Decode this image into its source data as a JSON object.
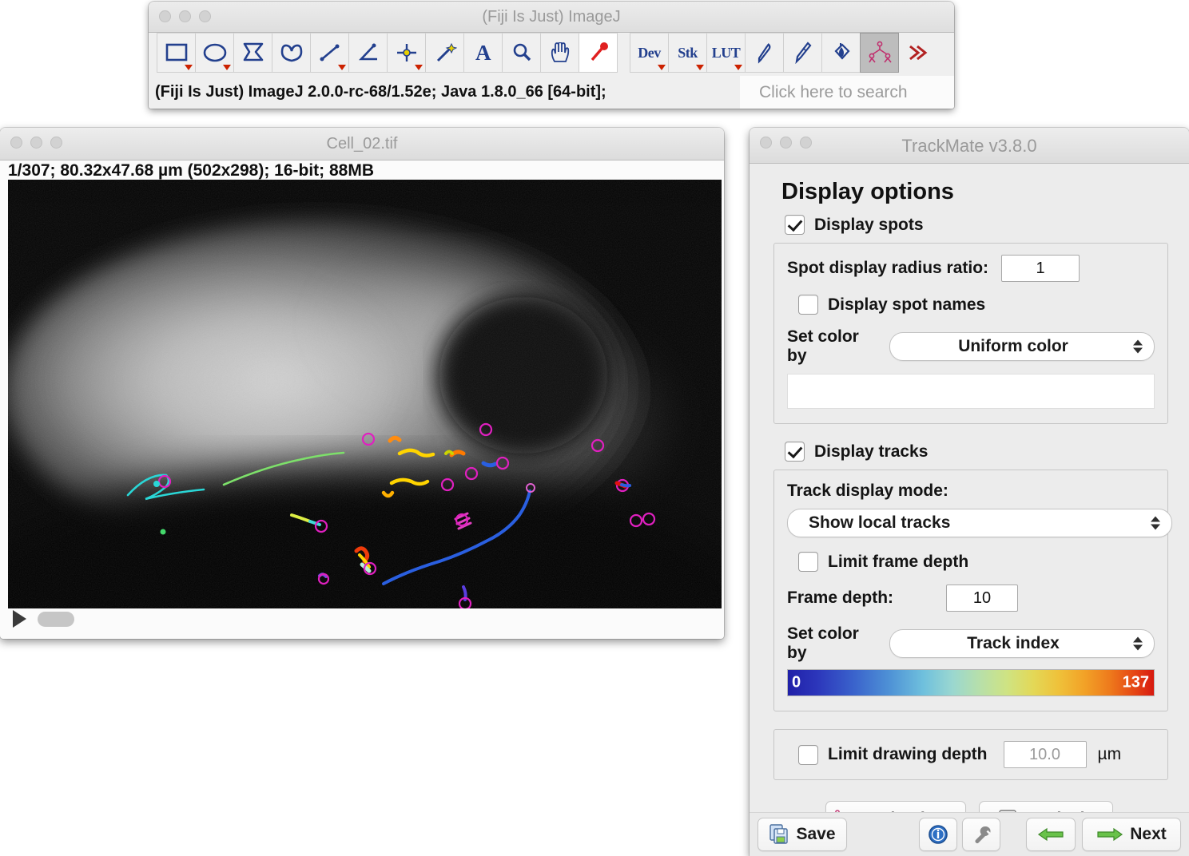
{
  "fiji": {
    "title": "(Fiji Is Just) ImageJ",
    "status": "(Fiji Is Just) ImageJ 2.0.0-rc-68/1.52e; Java 1.8.0_66 [64-bit];",
    "search_placeholder": "Click here to search",
    "tools": [
      {
        "name": "rectangle-tool",
        "icon": "rectangle-icon",
        "dropdown": true,
        "selected": false
      },
      {
        "name": "oval-tool",
        "icon": "oval-icon",
        "dropdown": true,
        "selected": false
      },
      {
        "name": "polygon-tool",
        "icon": "polygon-icon",
        "dropdown": false,
        "selected": false
      },
      {
        "name": "freehand-tool",
        "icon": "freehand-icon",
        "dropdown": false,
        "selected": false
      },
      {
        "name": "line-tool",
        "icon": "line-icon",
        "dropdown": true,
        "selected": false
      },
      {
        "name": "angle-tool",
        "icon": "angle-icon",
        "dropdown": false,
        "selected": false
      },
      {
        "name": "point-tool",
        "icon": "point-icon",
        "dropdown": true,
        "selected": false
      },
      {
        "name": "wand-tool",
        "icon": "wand-icon",
        "dropdown": false,
        "selected": false
      },
      {
        "name": "text-tool",
        "icon": "text-a-icon",
        "label": "A",
        "dropdown": false,
        "selected": false
      },
      {
        "name": "zoom-tool",
        "icon": "magnifier-icon",
        "dropdown": false,
        "selected": false
      },
      {
        "name": "hand-tool",
        "icon": "hand-icon",
        "dropdown": false,
        "selected": false
      },
      {
        "name": "dropper-tool",
        "icon": "eyedropper-icon",
        "dropdown": false,
        "selected": false
      },
      {
        "name": "dev-menu",
        "icon": "dev-text-icon",
        "label": "Dev",
        "dropdown": true,
        "selected": false
      },
      {
        "name": "stk-menu",
        "icon": "stk-text-icon",
        "label": "Stk",
        "dropdown": true,
        "selected": false
      },
      {
        "name": "lut-menu",
        "icon": "lut-text-icon",
        "label": "LUT",
        "dropdown": true,
        "selected": false
      },
      {
        "name": "pencil-tool",
        "icon": "pencil-icon",
        "dropdown": false,
        "selected": false
      },
      {
        "name": "brush-tool",
        "icon": "paintbrush-icon",
        "dropdown": false,
        "selected": false
      },
      {
        "name": "fill-tool",
        "icon": "paint-bucket-icon",
        "dropdown": false,
        "selected": false
      },
      {
        "name": "trackmate-tool",
        "icon": "trackmate-icon",
        "dropdown": false,
        "selected": true
      },
      {
        "name": "more-tools",
        "icon": "double-chevron-right-icon",
        "dropdown": false,
        "selected": false
      }
    ]
  },
  "image_window": {
    "title": "Cell_02.tif",
    "info": "1/307; 80.32x47.68 µm (502x298); 16-bit; 88MB",
    "play_label": "play"
  },
  "trackmate": {
    "title": "TrackMate v3.8.0",
    "heading": "Display options",
    "display_spots": {
      "label": "Display spots",
      "checked": true
    },
    "spot_radius": {
      "label": "Spot display radius ratio:",
      "value": "1"
    },
    "display_spot_names": {
      "label": "Display spot names",
      "checked": false
    },
    "spot_color_by": {
      "label": "Set color by",
      "value": "Uniform color",
      "swatch_color": "#ffffff"
    },
    "display_tracks": {
      "label": "Display tracks",
      "checked": true
    },
    "track_display_mode": {
      "label": "Track display mode:",
      "value": "Show local tracks"
    },
    "limit_frame_depth": {
      "label": "Limit frame depth",
      "checked": false
    },
    "frame_depth": {
      "label": "Frame depth:",
      "value": "10"
    },
    "track_color_by": {
      "label": "Set color by",
      "value": "Track index"
    },
    "colorbar": {
      "min": "0",
      "max": "137",
      "start_color": "#2020a8",
      "end_color": "#d71a10"
    },
    "limit_drawing_depth": {
      "label": "Limit drawing depth",
      "checked": false,
      "value": "10.0",
      "unit": "µm"
    },
    "buttons": {
      "trackscheme": "TrackScheme",
      "analysis": "Analysis",
      "save": "Save",
      "next": "Next",
      "info_icon": "info-icon",
      "wrench_icon": "wrench-icon",
      "previous_icon": "arrow-left-icon",
      "next_icon": "arrow-right-icon"
    }
  }
}
